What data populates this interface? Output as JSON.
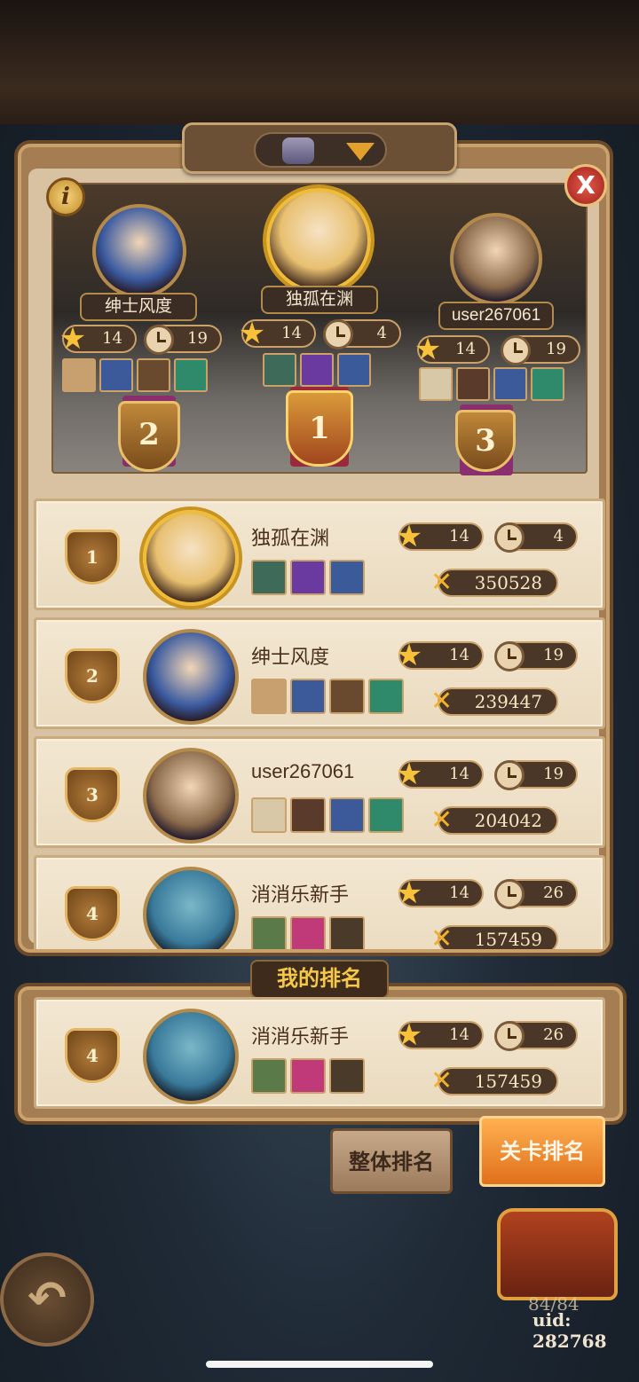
{
  "podium": [
    {
      "rank": "2",
      "name": "绅士风度",
      "stars": "14",
      "time": "19",
      "heroes": [
        "#c8a070",
        "#3c5a9a",
        "#6a4a2e",
        "#2e8a6a"
      ],
      "avatar_color": "#3a5aa0"
    },
    {
      "rank": "1",
      "name": "独孤在渊",
      "stars": "14",
      "time": "4",
      "heroes": [
        "#3e6a5a",
        "#6a3aa0",
        "#3a5a9a"
      ],
      "avatar_color": "#e8c070"
    },
    {
      "rank": "3",
      "name": "user267061",
      "stars": "14",
      "time": "19",
      "heroes": [
        "#d8c8a8",
        "#5a3a2a",
        "#3c5a9a",
        "#2e8a6a"
      ],
      "avatar_color": "#8a6a4a"
    }
  ],
  "ranking": [
    {
      "rank": "1",
      "name": "独孤在渊",
      "stars": "14",
      "time": "4",
      "score": "350528",
      "heroes": [
        "#3e6a5a",
        "#6a3aa0",
        "#3a5a9a"
      ],
      "avatar_color": "#e8c070"
    },
    {
      "rank": "2",
      "name": "绅士风度",
      "stars": "14",
      "time": "19",
      "score": "239447",
      "heroes": [
        "#c8a070",
        "#3c5a9a",
        "#6a4a2e",
        "#2e8a6a"
      ],
      "avatar_color": "#3a5aa0"
    },
    {
      "rank": "3",
      "name": "user267061",
      "stars": "14",
      "time": "19",
      "score": "204042",
      "heroes": [
        "#d8c8a8",
        "#5a3a2a",
        "#3c5a9a",
        "#2e8a6a"
      ],
      "avatar_color": "#8a6a4a"
    },
    {
      "rank": "4",
      "name": "消消乐新手",
      "stars": "14",
      "time": "26",
      "score": "157459",
      "heroes": [
        "#5a7a4a",
        "#c03a7a",
        "#4a3a2a"
      ],
      "avatar_color": "#3a7a9a"
    }
  ],
  "my_rank": {
    "title": "我的排名",
    "rank": "4",
    "name": "消消乐新手",
    "stars": "14",
    "time": "26",
    "score": "157459",
    "heroes": [
      "#5a7a4a",
      "#c03a7a",
      "#4a3a2a"
    ],
    "avatar_color": "#3a7a9a"
  },
  "buttons": {
    "info": "i",
    "close": "X",
    "overall_rank": "整体排名",
    "level_rank": "关卡排名",
    "back": "↶"
  },
  "footer": {
    "progress": "84/84",
    "uid": "uid: 282768"
  },
  "icons": {
    "star": "star-icon",
    "clock": "clock-icon",
    "score": "crossed-swords-icon"
  },
  "colors": {
    "panel": "#a57d53",
    "card": "#f3e7d2",
    "accent_orange": "#e0701a",
    "gold": "#f0bd3a"
  }
}
